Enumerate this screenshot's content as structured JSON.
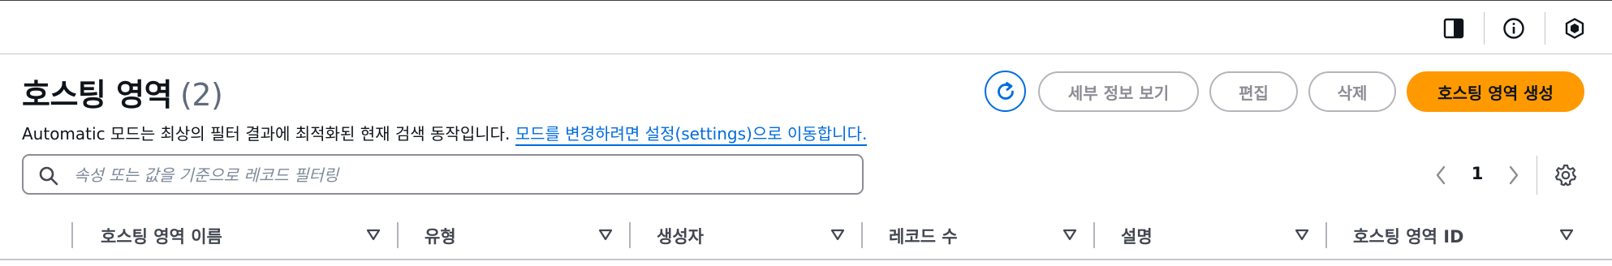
{
  "topbar": {
    "icons": [
      "panel-icon",
      "info-icon",
      "cube-icon"
    ]
  },
  "header": {
    "title": "호스팅 영역",
    "count": "(2)"
  },
  "actions": {
    "refresh_icon": "refresh-icon",
    "view_details": "세부 정보 보기",
    "edit": "편집",
    "delete": "삭제",
    "create": "호스팅 영역 생성"
  },
  "description": {
    "text": "Automatic 모드는 최상의 필터 결과에 최적화된 현재 검색 동작입니다. ",
    "link": "모드를 변경하려면 설정(settings)으로 이동합니다."
  },
  "search": {
    "placeholder": "속성 또는 값을 기준으로 레코드 필터링",
    "value": ""
  },
  "pagination": {
    "current_page": "1"
  },
  "table": {
    "columns": [
      "호스팅 영역 이름",
      "유형",
      "생성자",
      "레코드 수",
      "설명",
      "호스팅 영역 ID"
    ]
  },
  "colors": {
    "accent": "#006ce0",
    "primary_button": "#ff9900",
    "border": "#c6c6cd",
    "muted_text": "#8c8c94"
  }
}
